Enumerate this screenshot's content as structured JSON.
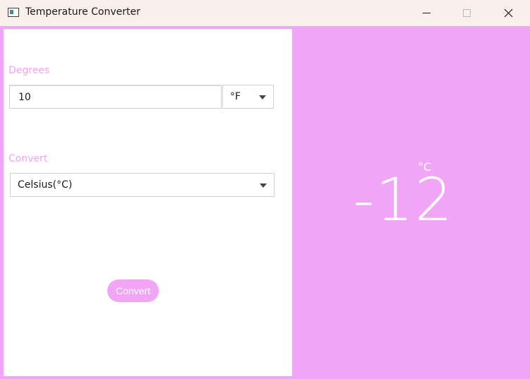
{
  "window": {
    "title": "Temperature Converter"
  },
  "icons": {
    "app": "app-window-icon",
    "minimize": "minimize-icon",
    "maximize": "maximize-icon",
    "close": "close-icon",
    "dropdown": "chevron-down-icon"
  },
  "form": {
    "degrees_label": "Degrees",
    "degrees_value": "10",
    "unit_selected": "°F",
    "convert_label": "Convert",
    "convert_selected": "Celsius(°C)",
    "convert_button": "Convert"
  },
  "result": {
    "value": "-12",
    "unit": "°C"
  },
  "colors": {
    "accent": "#f1a5f6",
    "titlebar": "#f9efeb",
    "panel": "#ffffff"
  }
}
